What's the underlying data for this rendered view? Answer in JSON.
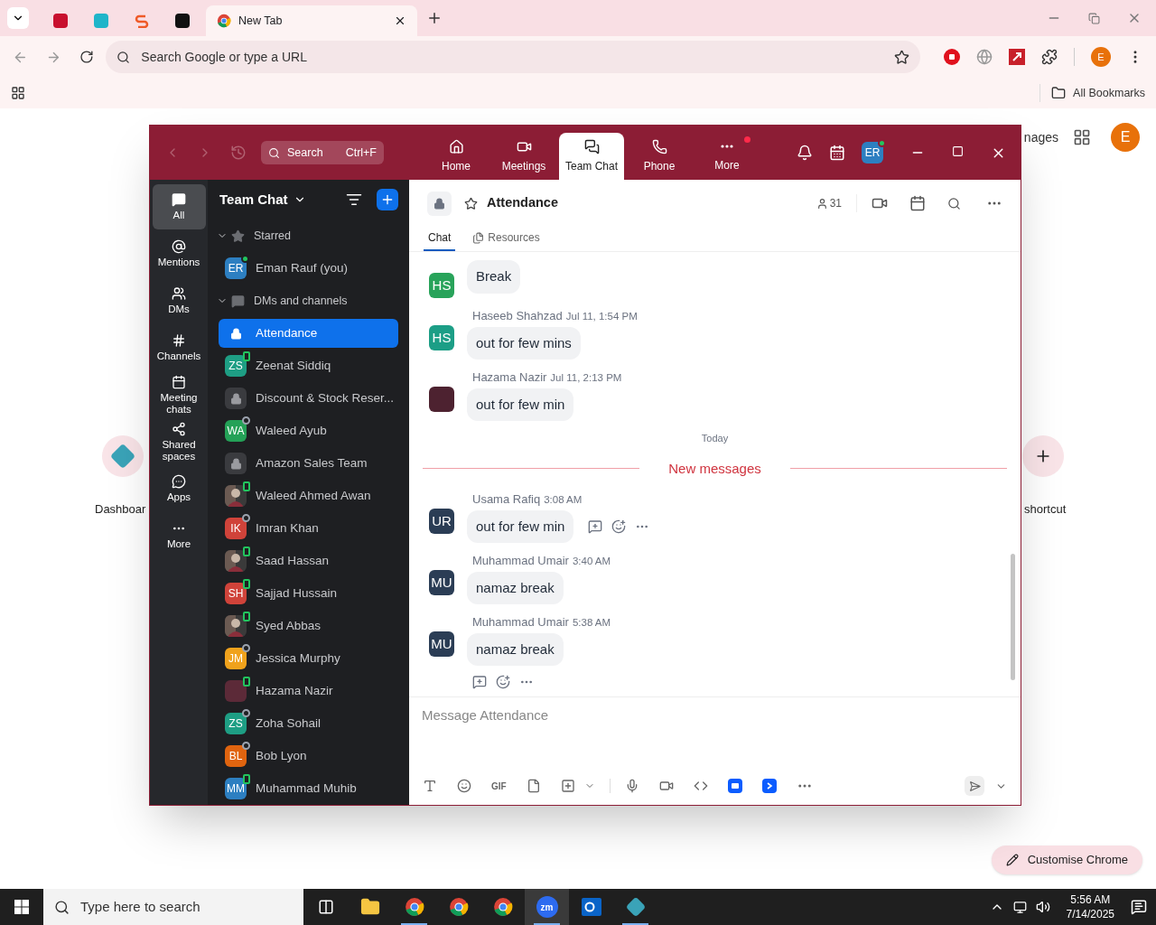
{
  "browser": {
    "tabs": [
      {
        "kind": "red",
        "selected": false
      },
      {
        "kind": "teal",
        "selected": false
      },
      {
        "kind": "orange",
        "selected": false
      },
      {
        "kind": "dark",
        "selected": false
      },
      {
        "kind": "chrome",
        "label": "New Tab",
        "selected": true
      }
    ],
    "omnibox": {
      "placeholder": "Search Google or type a URL"
    },
    "profile": "E",
    "bookmarks": {
      "label": "All Bookmarks"
    },
    "page": {
      "link": "nages",
      "profile": "E",
      "shortcuts": [
        {
          "kind": "app",
          "label": "Dashboar"
        },
        {
          "kind": "add",
          "label": "shortcut"
        }
      ],
      "customise": "Customise Chrome"
    }
  },
  "zoom": {
    "search": {
      "placeholder": "Search",
      "shortcut": "Ctrl+F"
    },
    "nav": [
      {
        "label": "Home",
        "selected": false,
        "badge": false
      },
      {
        "label": "Meetings",
        "selected": false,
        "badge": false
      },
      {
        "label": "Team Chat",
        "selected": true,
        "badge": false
      },
      {
        "label": "Phone",
        "selected": false,
        "badge": false
      },
      {
        "label": "More",
        "selected": false,
        "badge": true
      }
    ],
    "user": {
      "initials": "ER",
      "available": true,
      "mobile": false
    },
    "rail": [
      {
        "kind": "all",
        "label": "All",
        "selected": true
      },
      {
        "kind": "mentions",
        "label": "Mentions",
        "selected": false
      },
      {
        "kind": "dms",
        "label": "DMs",
        "selected": false
      },
      {
        "kind": "channels",
        "label": "Channels",
        "selected": false
      },
      {
        "kind": "meetings",
        "label": "Meeting chats",
        "selected": false
      },
      {
        "kind": "spaces",
        "label": "Shared spaces",
        "selected": false
      },
      {
        "kind": "apps",
        "label": "Apps",
        "selected": false
      },
      {
        "kind": "more",
        "label": "More",
        "selected": false
      }
    ],
    "sidebar": {
      "title": "Team Chat",
      "sections": [
        {
          "title": "Starred",
          "kind": "starred",
          "expanded": true,
          "items": [
            {
              "kind": "person",
              "name": "Eman Rauf (you)",
              "initials": "ER",
              "color": "#2d7fc1",
              "available": true,
              "mobile": false,
              "selected": false
            }
          ]
        },
        {
          "title": "DMs and channels",
          "kind": "dms",
          "expanded": true,
          "items": [
            {
              "kind": "channel",
              "name": "Attendance",
              "selected": true
            },
            {
              "kind": "person",
              "name": "Zeenat Siddiq",
              "initials": "ZS",
              "color": "#1e9e84",
              "available": true,
              "mobile": true,
              "selected": false
            },
            {
              "kind": "channel",
              "name": "Discount & Stock Reser...",
              "selected": false
            },
            {
              "kind": "person",
              "name": "Waleed Ayub",
              "initials": "WA",
              "color": "#24a157",
              "available": false,
              "mobile": false,
              "selected": false
            },
            {
              "kind": "channel",
              "name": "Amazon Sales Team",
              "selected": false
            },
            {
              "name": "Waleed Ahmed Awan",
              "available": true,
              "mobile": true,
              "selected": false
            },
            {
              "kind": "person",
              "name": "Imran Khan",
              "initials": "IK",
              "color": "#d0433a",
              "available": false,
              "mobile": false,
              "selected": false
            },
            {
              "name": "Saad Hassan",
              "available": true,
              "mobile": true,
              "selected": false
            },
            {
              "kind": "person",
              "name": "Sajjad Hussain",
              "initials": "SH",
              "color": "#d0433a",
              "available": true,
              "mobile": true,
              "selected": false
            },
            {
              "name": "Syed Abbas",
              "available": true,
              "mobile": true,
              "selected": false
            },
            {
              "kind": "person",
              "name": "Jessica Murphy",
              "initials": "JM",
              "color": "#f0a21c",
              "available": false,
              "mobile": false,
              "selected": false
            },
            {
              "kind": "blank",
              "name": "Hazama Nazir",
              "color": "#5c2a38",
              "available": true,
              "mobile": true,
              "selected": false
            },
            {
              "kind": "person",
              "name": "Zoha Sohail",
              "initials": "ZS",
              "color": "#1e9e84",
              "available": false,
              "mobile": false,
              "selected": false
            },
            {
              "kind": "person",
              "name": "Bob Lyon",
              "initials": "BL",
              "color": "#e0640f",
              "available": false,
              "mobile": false,
              "selected": false
            },
            {
              "kind": "person",
              "name": "Muhammad Muhib",
              "initials": "MM",
              "color": "#2d7fc1",
              "available": true,
              "mobile": true,
              "selected": false
            }
          ]
        }
      ]
    },
    "chat": {
      "title": "Attendance",
      "members": "31",
      "tabs": [
        {
          "label": "Chat",
          "selected": true
        },
        {
          "label": "Resources",
          "selected": false
        }
      ],
      "messages": [
        {
          "kind": "message",
          "initials": "HS",
          "color": "#28a35a",
          "text": "Break"
        },
        {
          "kind": "message",
          "sender": "Haseeb Shahzad",
          "time": "Jul 11, 1:54 PM",
          "initials": "HS",
          "color": "#1c9e86",
          "text": "out for few mins"
        },
        {
          "kind": "message",
          "sender": "Hazama Nazir",
          "time": "Jul 11, 2:13 PM",
          "color": "#4d2230",
          "text": "out for few min"
        },
        {
          "kind": "date",
          "text": "Today"
        },
        {
          "kind": "new",
          "text": "New messages"
        },
        {
          "kind": "message",
          "sender": "Usama Rafiq",
          "time": "3:08 AM",
          "initials": "UR",
          "color": "#2b3d55",
          "text": "out for few min",
          "actions_inline": true
        },
        {
          "kind": "message",
          "sender": "Muhammad Umair",
          "time": "3:40 AM",
          "initials": "MU",
          "color": "#2b3d55",
          "text": "namaz break"
        },
        {
          "kind": "message",
          "sender": "Muhammad Umair",
          "time": "5:38 AM",
          "initials": "MU",
          "color": "#2b3d55",
          "text": "namaz break",
          "actions_below": true
        }
      ],
      "composer": {
        "placeholder": "Message Attendance",
        "gif_label": "GIF"
      }
    }
  },
  "taskbar": {
    "search": {
      "placeholder": "Type here to search"
    },
    "apps": [
      {
        "kind": "taskview",
        "selected": false,
        "running": false
      },
      {
        "kind": "folder",
        "selected": false,
        "running": false
      },
      {
        "kind": "chrome",
        "selected": false,
        "running": true
      },
      {
        "kind": "chrome",
        "selected": false,
        "running": false
      },
      {
        "kind": "chrome",
        "selected": false,
        "running": false
      },
      {
        "kind": "zoom",
        "label": "zm",
        "selected": true,
        "running": true
      },
      {
        "kind": "outlook",
        "selected": false,
        "running": false
      },
      {
        "kind": "gem",
        "selected": false,
        "running": true
      }
    ],
    "time": "5:56 AM",
    "date": "7/14/2025"
  }
}
